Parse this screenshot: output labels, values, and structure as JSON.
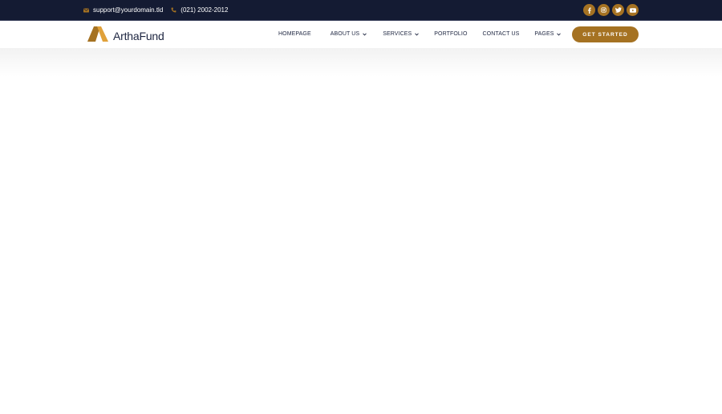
{
  "topbar": {
    "email": "support@yourdomain.tld",
    "phone": "(021) 2002-2012",
    "socials": [
      {
        "icon": "facebook-icon"
      },
      {
        "icon": "instagram-icon"
      },
      {
        "icon": "twitter-icon"
      },
      {
        "icon": "youtube-icon"
      }
    ]
  },
  "brand": {
    "name": "ArthaFund"
  },
  "nav": {
    "items": [
      {
        "label": "HOMEPAGE"
      },
      {
        "label": "ABOUT US"
      },
      {
        "label": "SERVICES"
      },
      {
        "label": "PORTFOLIO"
      },
      {
        "label": "CONTACT US"
      },
      {
        "label": "PAGES"
      }
    ],
    "cta_label": "GET STARTED"
  },
  "colors": {
    "topbar_bg": "#141b33",
    "accent": "#a57222",
    "text_dark": "#1d2540"
  }
}
